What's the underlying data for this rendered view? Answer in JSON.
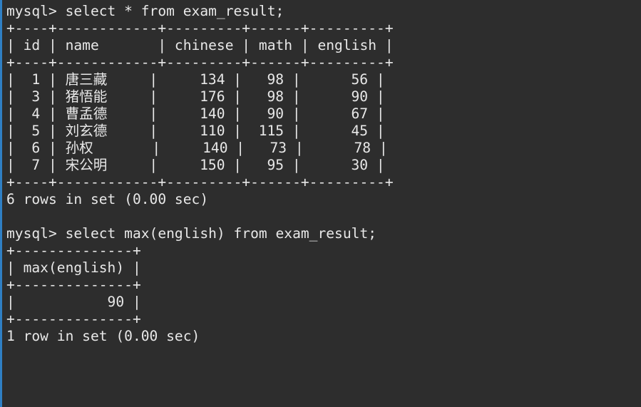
{
  "terminal": {
    "prompt": "mysql> ",
    "background_color": "#2d2d2d",
    "text_color": "#e8e8e8",
    "accent_border_color": "#2f7fc4",
    "commands": [
      "select * from exam_result;",
      "select max(english) from exam_result;"
    ],
    "status_lines": [
      "6 rows in set (0.00 sec)",
      "1 row in set (0.00 sec)"
    ]
  },
  "query1": {
    "command_line": "mysql> select * from exam_result;",
    "separator": "+----+------------+---------+------+---------+",
    "header_line": "| id | name       | chinese | math | english |",
    "columns": [
      "id",
      "name",
      "chinese",
      "math",
      "english"
    ],
    "rows": [
      {
        "id": "1",
        "name": "唐三藏",
        "chinese": "134",
        "math": "98",
        "english": "56",
        "line": "|  1 | 唐三藏     |     134 |   98 |      56 |"
      },
      {
        "id": "3",
        "name": "猪悟能",
        "chinese": "176",
        "math": "98",
        "english": "90",
        "line": "|  3 | 猪悟能     |     176 |   98 |      90 |"
      },
      {
        "id": "4",
        "name": "曹孟德",
        "chinese": "140",
        "math": "90",
        "english": "67",
        "line": "|  4 | 曹孟德     |     140 |   90 |      67 |"
      },
      {
        "id": "5",
        "name": "刘玄德",
        "chinese": "110",
        "math": "115",
        "english": "45",
        "line": "|  5 | 刘玄德     |     110 |  115 |      45 |"
      },
      {
        "id": "6",
        "name": "孙权",
        "chinese": "140",
        "math": "73",
        "english": "78",
        "line": "|  6 | 孙权       |     140 |   73 |      78 |"
      },
      {
        "id": "7",
        "name": "宋公明",
        "chinese": "150",
        "math": "95",
        "english": "30",
        "line": "|  7 | 宋公明     |     150 |   95 |      30 |"
      }
    ],
    "result_count": "6 rows in set (0.00 sec)"
  },
  "query2": {
    "command_line": "mysql> select max(english) from exam_result;",
    "separator": "+--------------+",
    "header_line": "| max(english) |",
    "columns": [
      "max(english)"
    ],
    "rows": [
      {
        "value": "90",
        "line": "|           90 |"
      }
    ],
    "result_count": "1 row in set (0.00 sec)"
  }
}
